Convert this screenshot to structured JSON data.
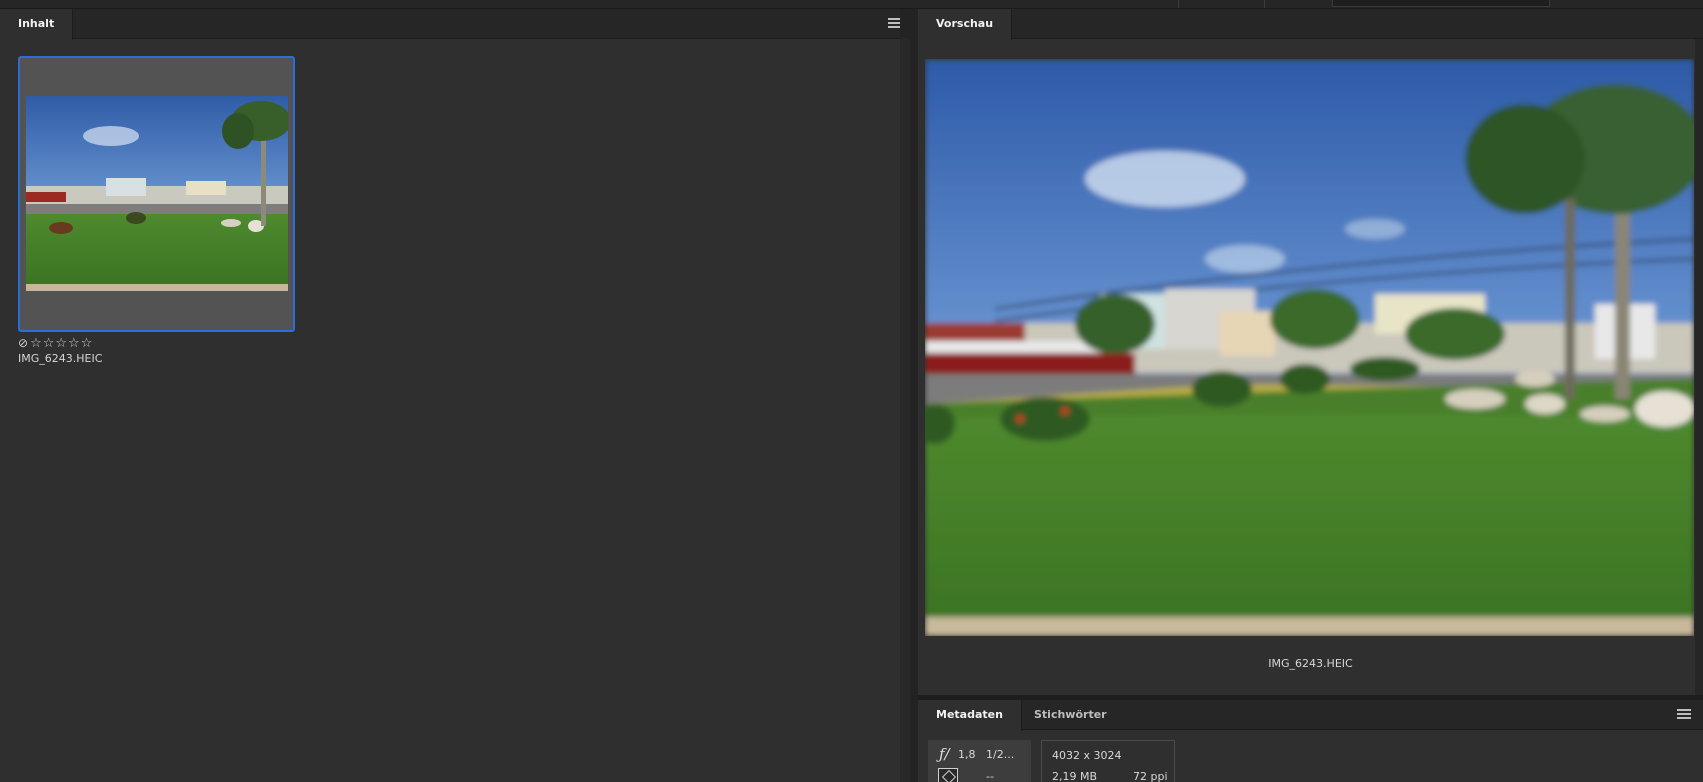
{
  "content_panel": {
    "tab_label": "Inhalt",
    "thumbnail": {
      "reject_symbol": "⊘",
      "stars": "☆☆☆☆☆",
      "filename": "IMG_6243.HEIC"
    }
  },
  "preview_panel": {
    "tab_label": "Vorschau",
    "filename": "IMG_6243.HEIC"
  },
  "meta_panel": {
    "tabs": [
      "Metadaten",
      "Stichwörter"
    ],
    "aperture": "1,8",
    "shutter": "1/2...",
    "metering": "--",
    "dimensions": "4032 x 3024",
    "file_size": "2,19 MB",
    "resolution": "72 ppi"
  },
  "colors": {
    "panel_bg": "#2f2f2f",
    "selection_border": "#2b6fd6"
  }
}
